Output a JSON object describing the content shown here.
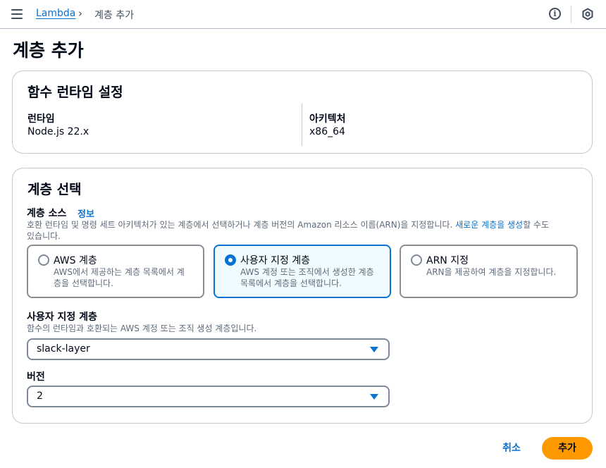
{
  "header": {
    "menu_icon": "hamburger-icon",
    "breadcrumb": {
      "service": "Lambda",
      "separator": "›",
      "current": "계층 추가"
    },
    "info_icon": "info-icon",
    "settings_icon": "settings-hex-icon"
  },
  "page": {
    "title": "계층 추가"
  },
  "runtime_settings": {
    "title": "함수 런타임 설정",
    "runtime_label": "런타임",
    "runtime_value": "Node.js 22.x",
    "architecture_label": "아키텍처",
    "architecture_value": "x86_64"
  },
  "layer_selection": {
    "title": "계층 선택",
    "source_label": "계층 소스",
    "info_link": "정보",
    "source_description_line1": "호환 런타임 및 명령 세트 아키텍처가 있는 계층에서 선택하거나 계층 버전의 Amazon 리소스 이름(ARN)을 지정합니다.",
    "new_layer_link": "새로운 계층을 생성",
    "source_description_tail": "할 수도",
    "source_description_line2": "있습니다.",
    "options": [
      {
        "label": "AWS 계층",
        "desc1": "AWS에서 제공하는 계층 목록에서 계",
        "desc2": "층을 선택합니다.",
        "selected": false
      },
      {
        "label": "사용자 지정 계층",
        "desc1": "AWS 계정 또는 조직에서 생성한 계층",
        "desc2": "목록에서 계층을 선택합니다.",
        "selected": true
      },
      {
        "label": "ARN 지정",
        "desc1": "ARN을 제공하여 계층을 지정합니다.",
        "desc2": "",
        "selected": false
      }
    ],
    "custom_layer_label": "사용자 지정 계층",
    "custom_layer_description": "함수의 런타임과 호환되는 AWS 계정 또는 조직 생성 계층입니다.",
    "custom_layer_value": "slack-layer",
    "version_label": "버전",
    "version_value": "2"
  },
  "footer": {
    "cancel": "취소",
    "submit": "추가"
  },
  "colors": {
    "accent": "#0972d3",
    "primary_button": "#ff9900",
    "selected_tile_bg": "#f0fbff"
  }
}
